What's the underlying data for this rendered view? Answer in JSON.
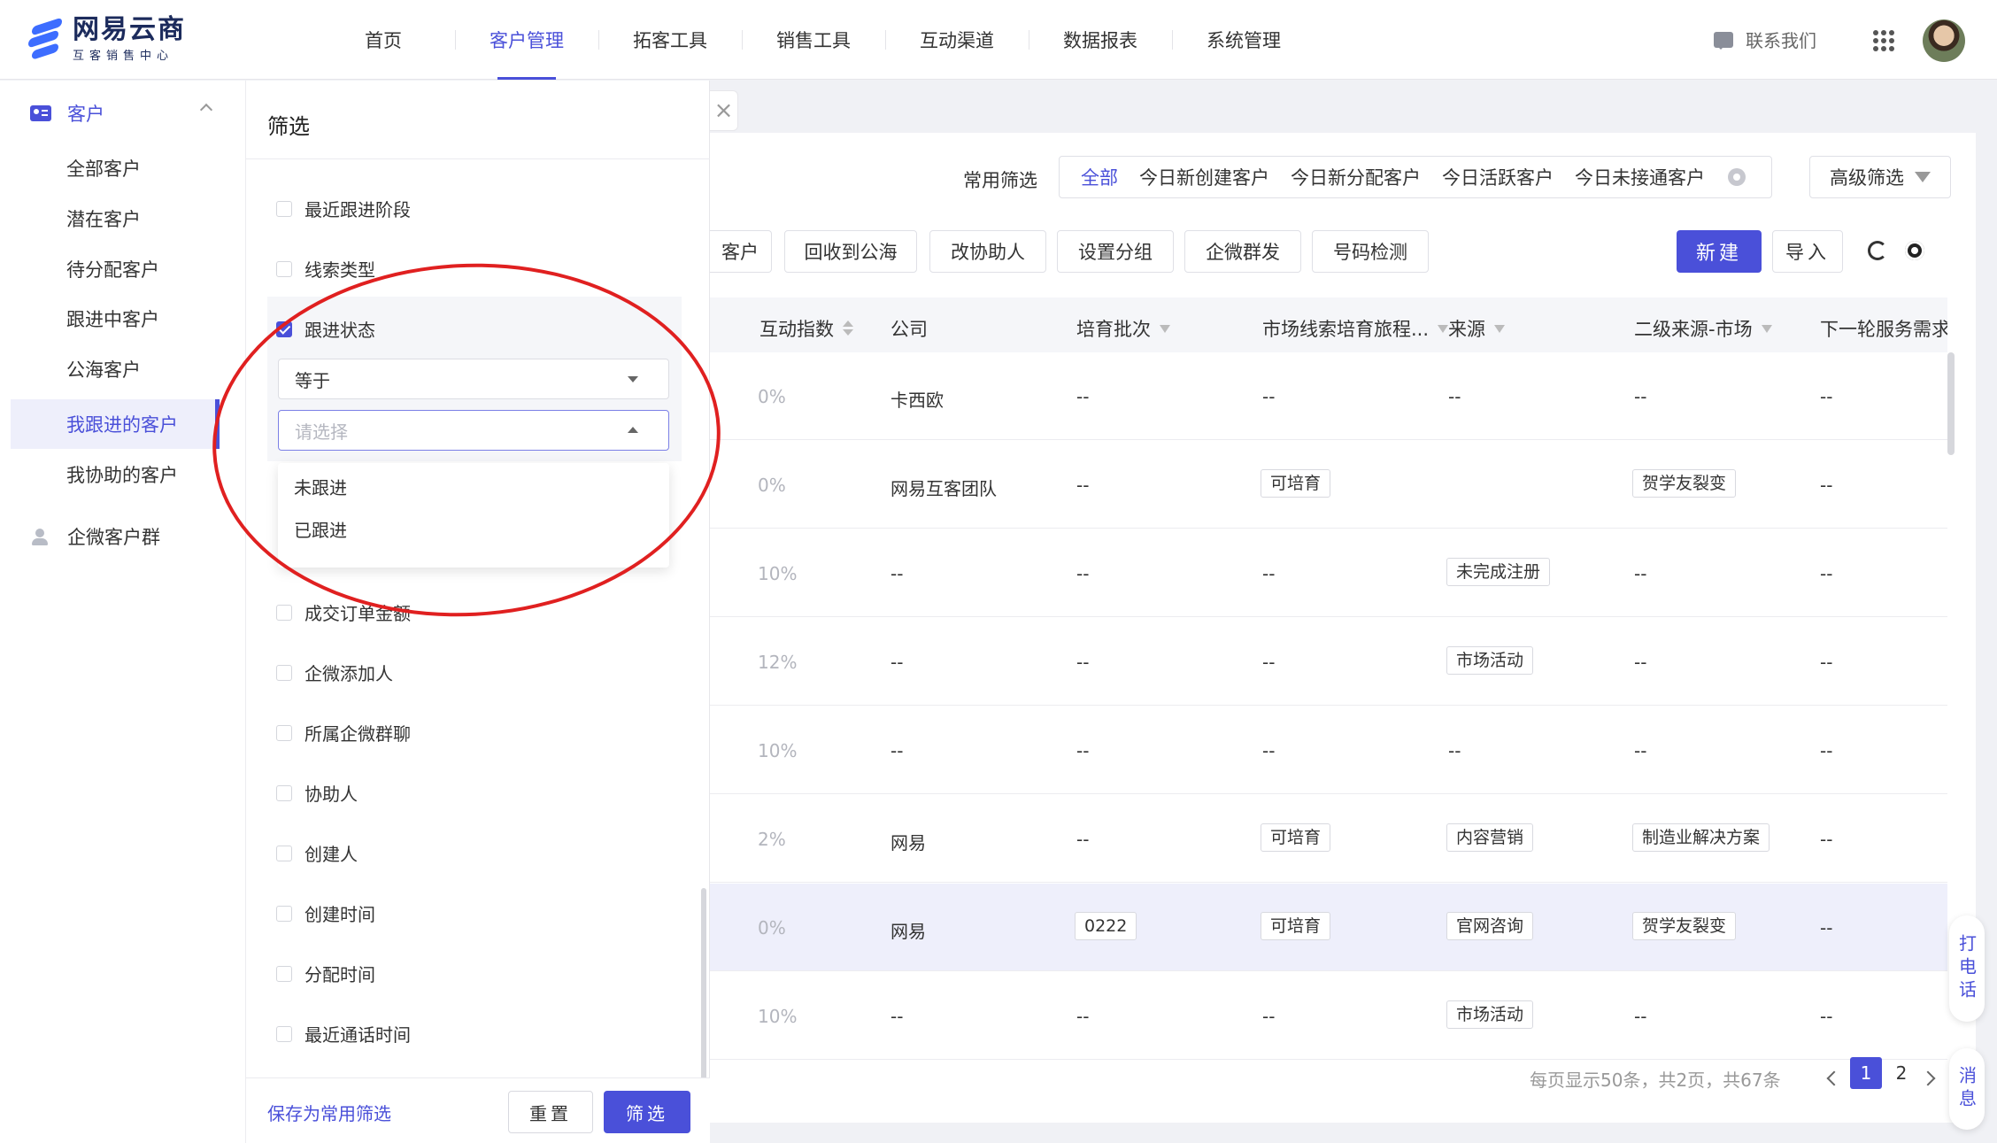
{
  "brand": {
    "title": "网易云商",
    "subtitle": "互客销售中心"
  },
  "nav": {
    "items": [
      {
        "label": "首页",
        "active": false
      },
      {
        "label": "客户管理",
        "active": true
      },
      {
        "label": "拓客工具",
        "active": false
      },
      {
        "label": "销售工具",
        "active": false
      },
      {
        "label": "互动渠道",
        "active": false
      },
      {
        "label": "数据报表",
        "active": false
      },
      {
        "label": "系统管理",
        "active": false
      }
    ],
    "contact": "联系我们"
  },
  "sidebar": {
    "group_customer": "客户",
    "items": [
      "全部客户",
      "潜在客户",
      "待分配客户",
      "跟进中客户",
      "公海客户",
      "我跟进的客户",
      "我协助的客户"
    ],
    "active_item": "我跟进的客户",
    "group_wechat": "企微客户群"
  },
  "filter": {
    "title": "筛选",
    "close": "×",
    "fields": [
      {
        "label": "最近跟进阶段",
        "checked": false
      },
      {
        "label": "线索类型",
        "checked": false
      },
      {
        "label": "跟进状态",
        "checked": true
      },
      {
        "label": "成交订单金额",
        "checked": false
      },
      {
        "label": "企微添加人",
        "checked": false
      },
      {
        "label": "所属企微群聊",
        "checked": false
      },
      {
        "label": "协助人",
        "checked": false
      },
      {
        "label": "创建人",
        "checked": false
      },
      {
        "label": "创建时间",
        "checked": false
      },
      {
        "label": "分配时间",
        "checked": false
      },
      {
        "label": "最近通话时间",
        "checked": false
      }
    ],
    "operator": "等于",
    "value_placeholder": "请选择",
    "options": [
      "未跟进",
      "已跟进"
    ],
    "save_label": "保存为常用筛选",
    "reset_label": "重置",
    "apply_label": "筛选"
  },
  "toolbar": {
    "common_label": "常用筛选",
    "quick": [
      "全部",
      "今日新创建客户",
      "今日新分配客户",
      "今日活跃客户",
      "今日未接通客户"
    ],
    "advanced": "高级筛选",
    "actions": [
      "转客户",
      "回收到公海",
      "改协助人",
      "设置分组",
      "企微群发",
      "号码检测"
    ],
    "actions_visible": [
      "客户",
      "回收到公海",
      "改协助人",
      "设置分组",
      "企微群发",
      "号码检测"
    ],
    "new_label": "新建",
    "import_label": "导入"
  },
  "table": {
    "columns": [
      "互动指数",
      "公司",
      "培育批次",
      "市场线索培育旅程...",
      "来源",
      "二级来源-市场",
      "下一轮服务需求"
    ],
    "rows": [
      {
        "index": "0%",
        "company": "卡西欧",
        "batch": "--",
        "journey": "--",
        "source": "--",
        "sub": "--",
        "next": "--"
      },
      {
        "index": "0%",
        "company": "网易互客团队",
        "batch": "--",
        "journey": "可培育",
        "source": "",
        "sub": "贺学友裂变",
        "next": "--"
      },
      {
        "index": "10%",
        "company": "--",
        "batch": "--",
        "journey": "--",
        "source": "未完成注册",
        "sub": "--",
        "next": "--"
      },
      {
        "index": "12%",
        "company": "--",
        "batch": "--",
        "journey": "--",
        "source": "市场活动",
        "sub": "--",
        "next": "--"
      },
      {
        "index": "10%",
        "company": "--",
        "batch": "--",
        "journey": "--",
        "source": "--",
        "sub": "--",
        "next": "--"
      },
      {
        "index": "2%",
        "company": "网易",
        "batch": "--",
        "journey": "可培育",
        "source": "内容营销",
        "sub": "制造业解决方案",
        "next": "--"
      },
      {
        "index": "0%",
        "company": "网易",
        "batch": "0222",
        "journey": "可培育",
        "source": "官网咨询",
        "sub": "贺学友裂变",
        "next": "--"
      },
      {
        "index": "10%",
        "company": "--",
        "batch": "--",
        "journey": "--",
        "source": "市场活动",
        "sub": "--",
        "next": "--"
      }
    ],
    "highlighted_row": 6
  },
  "pagination": {
    "summary": "每页显示50条，共2页，共67条",
    "current": "1",
    "next_page": "2"
  },
  "floating": {
    "call": "打电话",
    "message": "消息"
  },
  "colors": {
    "accent": "#4a50d9",
    "annotation": "#e02020"
  }
}
